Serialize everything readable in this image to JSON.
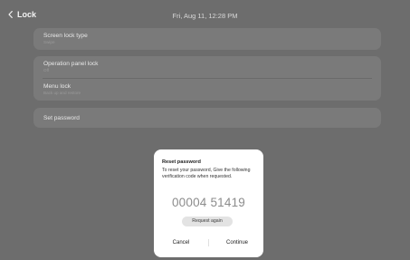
{
  "header": {
    "back_label": "Lock",
    "datetime": "Fri, Aug 11, 12:28 PM"
  },
  "settings": {
    "screen_lock_type": {
      "title": "Screen lock type",
      "value": "Swipe"
    },
    "operation_panel_lock": {
      "title": "Operation panel lock",
      "value": "Off"
    },
    "menu_lock": {
      "title": "Menu lock",
      "value": "Back up and restore"
    },
    "set_password": {
      "title": "Set password"
    }
  },
  "dialog": {
    "title": "Reset password",
    "message": "To reset your password, Give the following verification code when requested.",
    "code": "00004 51419",
    "request_again": "Request again",
    "cancel": "Cancel",
    "continue": "Continue"
  },
  "colors": {
    "dimmed_background": "#6d6d6d",
    "card_background": "#7a7a7a",
    "dialog_background": "#ffffff",
    "code_text": "#8c8c8c"
  },
  "icons": {
    "back": "chevron-left-icon"
  }
}
